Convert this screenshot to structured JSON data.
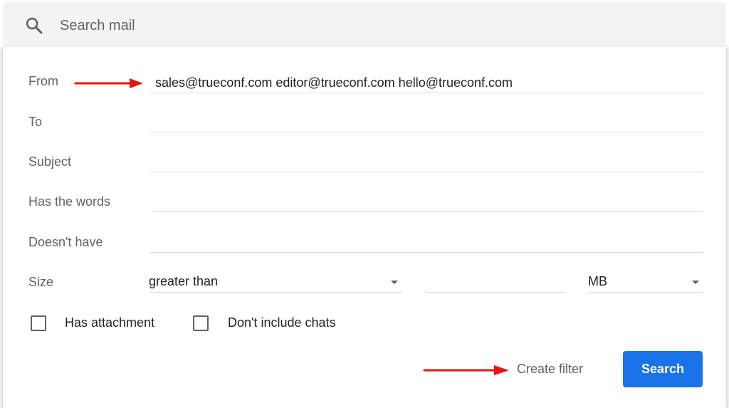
{
  "search": {
    "placeholder": "Search mail"
  },
  "form": {
    "from": {
      "label": "From",
      "value": "sales@trueconf.com editor@trueconf.com hello@trueconf.com"
    },
    "to": {
      "label": "To",
      "value": ""
    },
    "subject": {
      "label": "Subject",
      "value": ""
    },
    "has_words": {
      "label": "Has the words",
      "value": ""
    },
    "doesnt_have": {
      "label": "Doesn't have",
      "value": ""
    },
    "size": {
      "label": "Size",
      "comparison": "greater than",
      "value": "",
      "unit": "MB"
    },
    "has_attachment": {
      "label": "Has attachment",
      "checked": false
    },
    "dont_include_chats": {
      "label": "Don't include chats",
      "checked": false
    }
  },
  "actions": {
    "create_filter_label": "Create filter",
    "search_label": "Search"
  },
  "colors": {
    "accent": "#1a73e8",
    "arrow": "#e8140e",
    "label": "#5f6368"
  },
  "icons": {
    "search": "search-icon",
    "dropdown": "chevron-down-icon",
    "annotation": "red-arrow-icon"
  }
}
